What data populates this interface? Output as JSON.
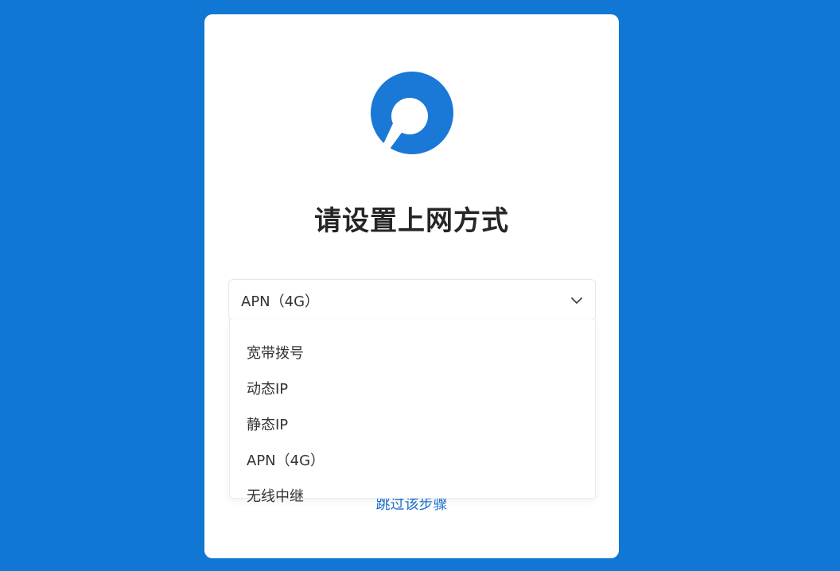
{
  "title": "请设置上网方式",
  "select": {
    "value": "APN（4G）",
    "options": [
      "宽带拨号",
      "动态IP",
      "静态IP",
      "APN（4G）",
      "无线中继"
    ]
  },
  "skip_label": "跳过该步骤",
  "colors": {
    "background": "#1177d4",
    "logo": "#1a78d6",
    "link": "#1d6fd0"
  },
  "icons": {
    "logo": "router-logo-icon",
    "chevron": "chevron-down-icon"
  }
}
